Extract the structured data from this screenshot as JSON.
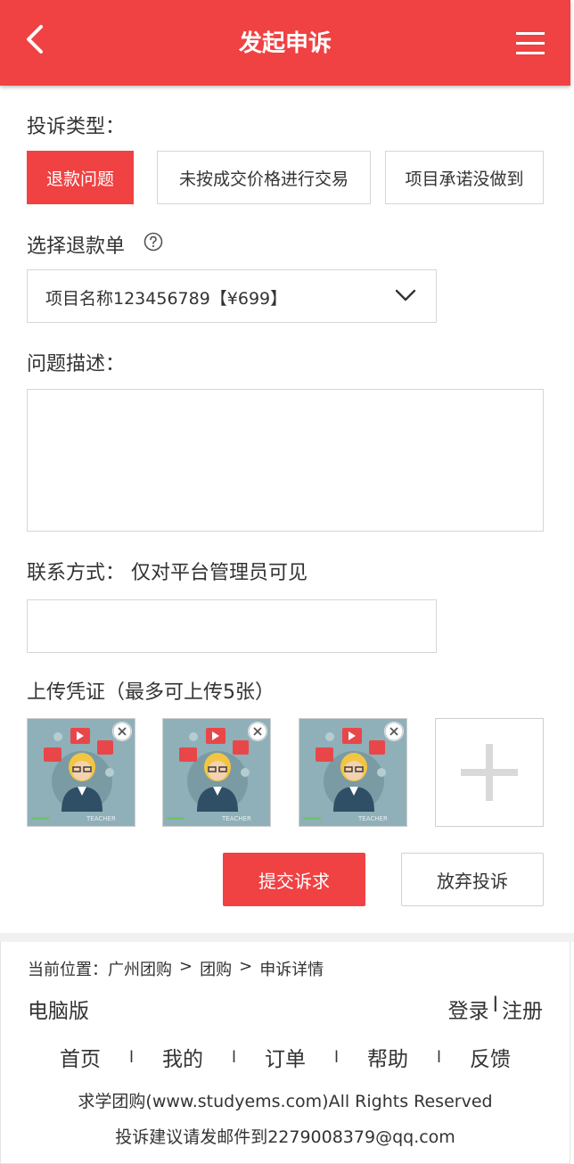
{
  "header": {
    "title": "发起申诉"
  },
  "complaint_type": {
    "label": "投诉类型：",
    "options": [
      {
        "label": "退款问题",
        "selected": true
      },
      {
        "label": "未按成交价格进行交易",
        "selected": false
      },
      {
        "label": "项目承诺没做到",
        "selected": false
      }
    ]
  },
  "refund_order": {
    "label": "选择退款单",
    "help_icon": "question-circle-icon",
    "selected_value": "项目名称123456789【¥699】"
  },
  "description": {
    "label": "问题描述：",
    "value": ""
  },
  "contact": {
    "label": "联系方式： 仅对平台管理员可见",
    "value": ""
  },
  "upload": {
    "label": "上传凭证（最多可上传5张）",
    "thumbnail_caption": "TEACHER",
    "images_count": 3
  },
  "actions": {
    "submit_label": "提交诉求",
    "cancel_label": "放弃投诉"
  },
  "footer": {
    "breadcrumb_prefix": "当前位置：",
    "breadcrumb": [
      "广州团购",
      "团购",
      "申诉详情"
    ],
    "breadcrumb_sep": ">",
    "pc_version": "电脑版",
    "login": "登录",
    "auth_sep": "l",
    "register": "注册",
    "nav": [
      "首页",
      "我的",
      "订单",
      "帮助",
      "反馈"
    ],
    "nav_sep": "l",
    "copyright": "求学团购(www.studyems.com)All Rights Reserved",
    "contact_line": "投诉建议请发邮件到2279008379@qq.com"
  },
  "colors": {
    "accent": "#f04143",
    "border": "#d6d6d6",
    "thumb_bg": "#8fb0b8"
  }
}
